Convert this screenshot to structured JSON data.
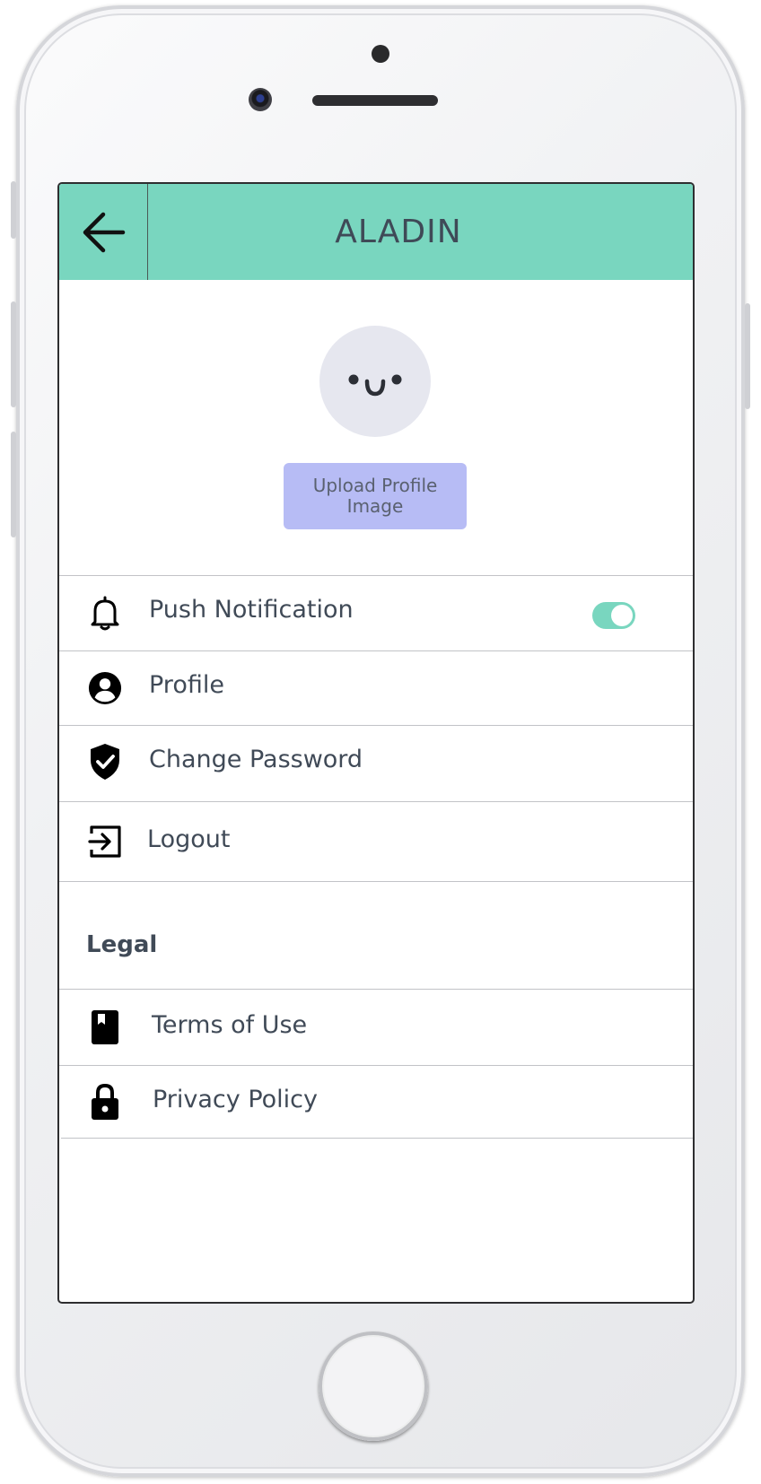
{
  "header": {
    "title": "ALADIN",
    "back_icon": "arrow-left-icon"
  },
  "profile": {
    "avatar_icon": "smiley-face-icon",
    "upload_label": "Upload Profile Image"
  },
  "settings": [
    {
      "label": "Push Notification",
      "icon": "bell-icon",
      "toggle": true
    },
    {
      "label": "Profile",
      "icon": "user-circle-icon"
    },
    {
      "label": "Change Password",
      "icon": "shield-check-icon"
    },
    {
      "label": "Logout",
      "icon": "logout-icon"
    }
  ],
  "legal": {
    "heading": "Legal",
    "items": [
      {
        "label": "Terms of Use",
        "icon": "book-icon"
      },
      {
        "label": "Privacy Policy",
        "icon": "lock-icon"
      }
    ]
  },
  "colors": {
    "header_bg": "#79d6bf",
    "accent": "#79d6bf",
    "upload_button_bg": "#b7bcf5",
    "text": "#404a57",
    "avatar_bg": "#e6e7ef"
  }
}
